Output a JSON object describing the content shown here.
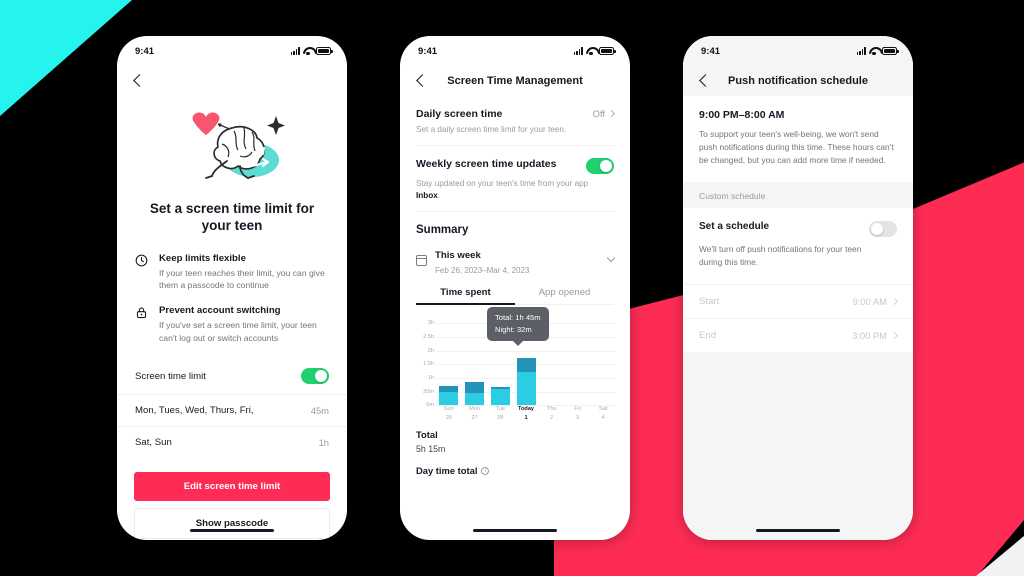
{
  "brand": {
    "cyan": "#25F4EE",
    "pink": "#FE2C55",
    "black": "#000000",
    "green": "#20D06F"
  },
  "status_bar": {
    "time": "9:41",
    "signal_icon": "signal-bars-icon",
    "wifi_icon": "wifi-icon",
    "battery_icon": "battery-icon"
  },
  "phone1": {
    "back_icon": "back-chevron-icon",
    "illustration": "running-brain-with-heart-illustration",
    "title": "Set a screen time limit for your teen",
    "features": [
      {
        "icon": "clock-icon",
        "heading": "Keep limits flexible",
        "body": "If your teen reaches their limit, you can give them a passcode to continue"
      },
      {
        "icon": "lock-icon",
        "heading": "Prevent account switching",
        "body": "If you've set a screen time limit, your teen can't log out or switch accounts"
      }
    ],
    "toggle_row": {
      "label": "Screen time limit",
      "state": "on"
    },
    "limits": [
      {
        "days": "Mon, Tues, Wed, Thurs, Fri,",
        "value": "45m"
      },
      {
        "days": "Sat, Sun",
        "value": "1h"
      }
    ],
    "primary_button": "Edit screen time limit",
    "secondary_button": "Show passcode"
  },
  "phone2": {
    "back_icon": "back-chevron-icon",
    "nav_title": "Screen Time Management",
    "daily": {
      "title": "Daily screen time",
      "subtitle": "Set a daily screen time limit for your teen.",
      "value": "Off",
      "chevron_icon": "chevron-right-icon"
    },
    "weekly": {
      "title": "Weekly screen time updates",
      "subtitle_prefix": "Stay updated on your teen's time from your app ",
      "subtitle_link": "Inbox",
      "subtitle_suffix": ".",
      "state": "on"
    },
    "summary_heading": "Summary",
    "week_selector": {
      "calendar_icon": "calendar-icon",
      "label": "This week",
      "range": "Feb 26, 2023–Mar 4, 2023",
      "chevron_icon": "chevron-down-icon"
    },
    "tabs": [
      {
        "label": "Time spent",
        "active": true
      },
      {
        "label": "App opened",
        "active": false
      }
    ],
    "tooltip": {
      "line1": "Total: 1h 45m",
      "line2": "Night: 32m"
    },
    "totals": {
      "total_label": "Total",
      "total_value": "5h 15m",
      "day_label": "Day time total",
      "info_icon": "info-icon"
    }
  },
  "phone3": {
    "back_icon": "back-chevron-icon",
    "nav_title": "Push notification schedule",
    "card": {
      "heading": "9:00 PM–8:00 AM",
      "body": "To support your teen's well-being, we won't send push notifications during this time. These hours can't be changed, but you can add more time if needed."
    },
    "group_heading": "Custom schedule",
    "schedule": {
      "title": "Set a schedule",
      "body": "We'll turn off push notifications for your teen during this time.",
      "state": "off"
    },
    "times": [
      {
        "label": "Start",
        "value": "9:00 AM",
        "chevron_icon": "chevron-right-icon"
      },
      {
        "label": "End",
        "value": "3:00 PM",
        "chevron_icon": "chevron-right-icon"
      }
    ]
  },
  "chart_data": {
    "type": "bar",
    "stacked": true,
    "title": "Time spent",
    "xlabel": "",
    "ylabel": "",
    "ylim": [
      0,
      3
    ],
    "ytick_labels": [
      "0m",
      "30m",
      "1h",
      "1.5h",
      "2h",
      "2.5h",
      "3h"
    ],
    "ytick_values": [
      0,
      0.5,
      1,
      1.5,
      2,
      2.5,
      3
    ],
    "grid": true,
    "legend": "none",
    "categories": [
      "Sun",
      "Mon",
      "Tue",
      "Today",
      "Thu",
      "Fri",
      "Sat"
    ],
    "category_dates": [
      "26",
      "27",
      "28",
      "1",
      "2",
      "3",
      "4"
    ],
    "highlight_index": 3,
    "series": [
      {
        "name": "Day",
        "color": "#2CCCE4",
        "values": [
          0.6,
          0.5,
          0.75,
          1.22
        ]
      },
      {
        "name": "Night",
        "color": "#2393B8",
        "values": [
          0.25,
          0.43,
          0.07,
          0.53
        ]
      }
    ],
    "totals": [
      0.85,
      0.93,
      0.82,
      1.75,
      0,
      0,
      0
    ],
    "annotations": [
      {
        "index": 3,
        "text": "Total: 1h 45m\nNight: 32m"
      }
    ]
  }
}
